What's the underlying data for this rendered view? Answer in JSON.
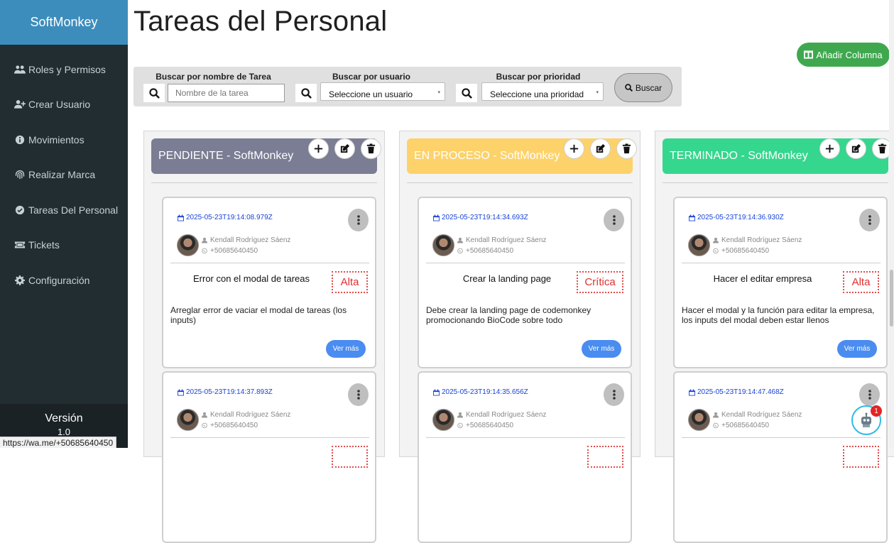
{
  "sidebar": {
    "brand": "SoftMonkey",
    "items": [
      {
        "label": "Roles y Permisos",
        "icon": "users-icon"
      },
      {
        "label": "Crear Usuario",
        "icon": "user-plus-icon"
      },
      {
        "label": "Movimientos",
        "icon": "info-circle-icon"
      },
      {
        "label": "Realizar Marca",
        "icon": "fingerprint-icon"
      },
      {
        "label": "Tareas Del Personal",
        "icon": "check-circle-icon"
      },
      {
        "label": "Tickets",
        "icon": "ticket-icon"
      },
      {
        "label": "Configuración",
        "icon": "gear-icon"
      }
    ],
    "version_label": "Versión",
    "version_number": "1.0"
  },
  "status_bar_url": "https://wa.me/+50685640450",
  "header": {
    "title": "Tareas del Personal",
    "add_column_label": "Añadir Columna"
  },
  "search": {
    "task_label": "Buscar por nombre de Tarea",
    "task_placeholder": "Nombre de la tarea",
    "user_label": "Buscar por usuario",
    "user_selected": "Seleccione un usuario",
    "priority_label": "Buscar por prioridad",
    "priority_selected": "Seleccione una prioridad",
    "button_label": "Buscar"
  },
  "columns": [
    {
      "title": "PENDIENTE - SoftMonkey",
      "color": "#7a7d93",
      "cards": [
        {
          "date": "2025-05-23T19:14:08.979Z",
          "user": "Kendall Rodríguez Sáenz",
          "phone": "+50685640450",
          "title": "Error con el modal de tareas",
          "priority": "Alta",
          "description": "Arreglar error de vaciar el modal de tareas (los inputs)",
          "button": "Ver más"
        },
        {
          "date": "2025-05-23T19:14:37.893Z",
          "user": "Kendall Rodríguez Sáenz",
          "phone": "+50685640450"
        }
      ]
    },
    {
      "title": "EN PROCESO - SoftMonkey",
      "color": "#fdd26a",
      "cards": [
        {
          "date": "2025-05-23T19:14:34.693Z",
          "user": "Kendall Rodríguez Sáenz",
          "phone": "+50685640450",
          "title": "Crear la landing page",
          "priority": "Crítica",
          "description": "Debe crear la landing page de codemonkey promocionando BioCode sobre todo",
          "button": "Ver más"
        },
        {
          "date": "2025-05-23T19:14:35.656Z",
          "user": "Kendall Rodríguez Sáenz",
          "phone": "+50685640450"
        }
      ]
    },
    {
      "title": "TERMINADO - SoftMonkey",
      "color": "#35d68e",
      "cards": [
        {
          "date": "2025-05-23T19:14:36.930Z",
          "user": "Kendall Rodríguez Sáenz",
          "phone": "+50685640450",
          "title": "Hacer el editar empresa",
          "priority": "Alta",
          "description": "Hacer el modal y la función para editar la empresa, los inputs del modal deben estar llenos",
          "button": "Ver más"
        },
        {
          "date": "2025-05-23T19:14:47.468Z",
          "user": "Kendall Rodríguez Sáenz",
          "phone": "+50685640450"
        }
      ]
    }
  ],
  "chat_bot": {
    "badge_count": "1"
  },
  "colors": {
    "brand": "#3c8dbc",
    "sidebar": "#222d32",
    "accent_green": "#3fa84f",
    "priority_red": "#e02f2f",
    "link_blue": "#1a44d6"
  }
}
